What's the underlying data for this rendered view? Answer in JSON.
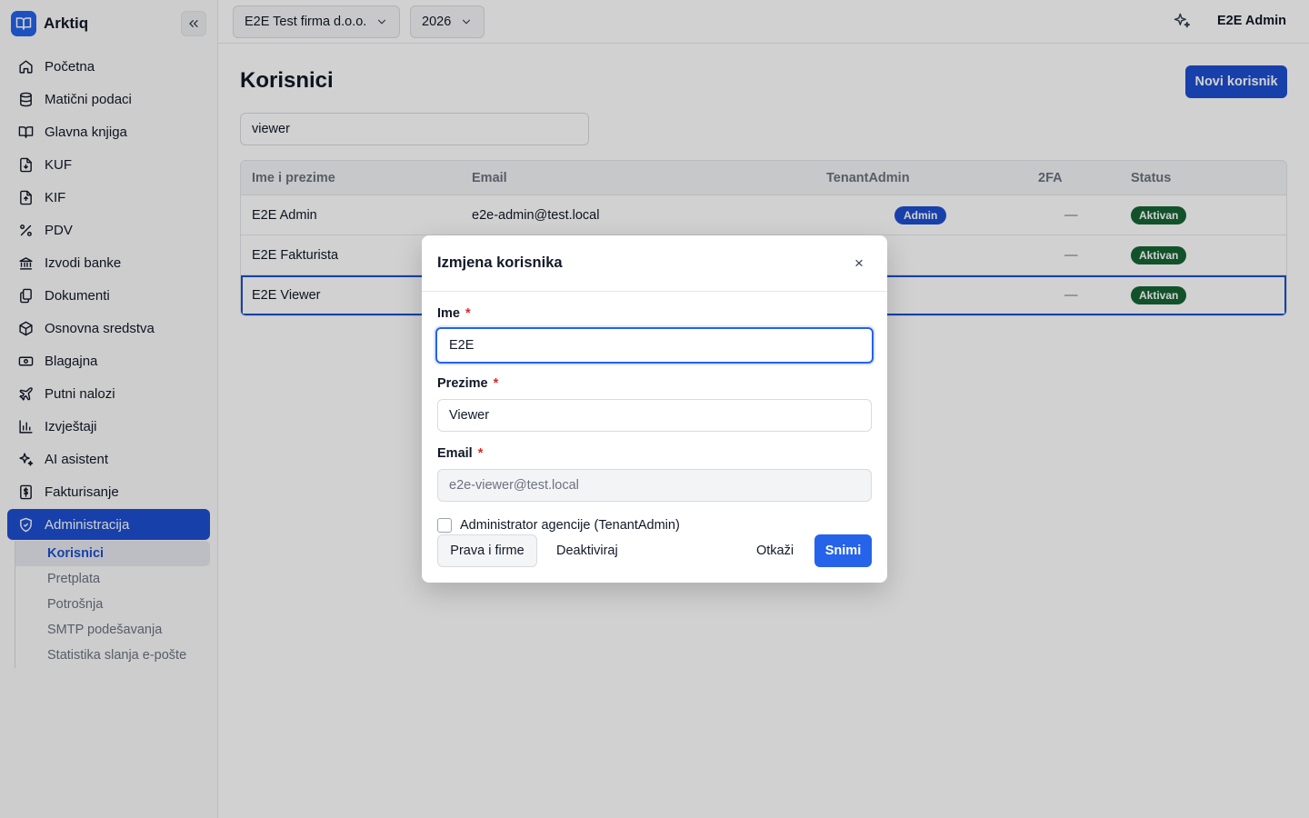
{
  "app": {
    "name": "Arktiq",
    "logo_icon": "book-open-icon",
    "accent": "#1e4fd0"
  },
  "topbar": {
    "company": "E2E Test firma d.o.o.",
    "year": "2026",
    "user": "E2E Admin"
  },
  "sidebar": {
    "items": [
      {
        "label": "Početna",
        "icon": "home-icon"
      },
      {
        "label": "Matični podaci",
        "icon": "database-icon"
      },
      {
        "label": "Glavna knjiga",
        "icon": "book-icon"
      },
      {
        "label": "KUF",
        "icon": "file-in-icon"
      },
      {
        "label": "KIF",
        "icon": "file-out-icon"
      },
      {
        "label": "PDV",
        "icon": "percent-icon"
      },
      {
        "label": "Izvodi banke",
        "icon": "bank-icon"
      },
      {
        "label": "Dokumenti",
        "icon": "documents-icon"
      },
      {
        "label": "Osnovna sredstva",
        "icon": "box-icon"
      },
      {
        "label": "Blagajna",
        "icon": "cash-icon"
      },
      {
        "label": "Putni nalozi",
        "icon": "plane-icon"
      },
      {
        "label": "Izvještaji",
        "icon": "bar-chart-icon"
      },
      {
        "label": "AI asistent",
        "icon": "sparkles-icon"
      },
      {
        "label": "Fakturisanje",
        "icon": "invoice-icon"
      },
      {
        "label": "Administracija",
        "icon": "shield-icon"
      }
    ],
    "sub_items": [
      {
        "label": "Korisnici"
      },
      {
        "label": "Pretplata"
      },
      {
        "label": "Potrošnja"
      },
      {
        "label": "SMTP podešavanja"
      },
      {
        "label": "Statistika slanja e-pošte"
      }
    ]
  },
  "main": {
    "title": "Korisnici",
    "new_button": "Novi korisnik",
    "search_value": "viewer",
    "table": {
      "headers": [
        "Ime i prezime",
        "Email",
        "TenantAdmin",
        "2FA",
        "Status"
      ],
      "rows": [
        {
          "name": "E2E Admin",
          "email": "e2e-admin@test.local",
          "tenant_admin": "Admin",
          "twofa": "—",
          "status": "Aktivan"
        },
        {
          "name": "E2E Fakturista",
          "email": "",
          "tenant_admin": "",
          "twofa": "—",
          "status": "Aktivan"
        },
        {
          "name": "E2E Viewer",
          "email": "",
          "tenant_admin": "",
          "twofa": "—",
          "status": "Aktivan"
        }
      ]
    }
  },
  "modal": {
    "title": "Izmjena korisnika",
    "close_symbol": "×",
    "first_name_label": "Ime",
    "first_name_value": "E2E",
    "last_name_label": "Prezime",
    "last_name_value": "Viewer",
    "email_label": "Email",
    "email_value": "e2e-viewer@test.local",
    "required_mark": "*",
    "checkbox_label": "Administrator agencije (TenantAdmin)",
    "rights_button": "Prava i firme",
    "deactivate_button": "Deaktiviraj",
    "cancel_button": "Otkaži",
    "save_button": "Snimi"
  }
}
